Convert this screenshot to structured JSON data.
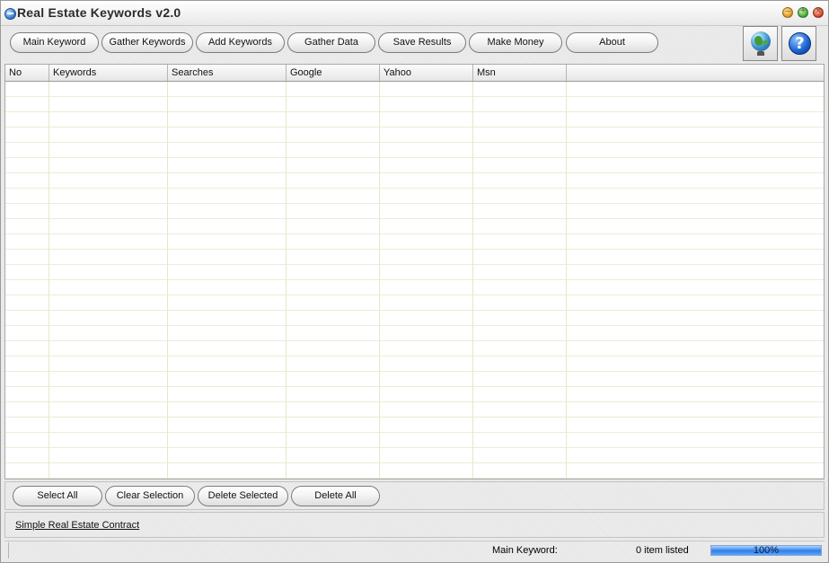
{
  "window": {
    "title": "Real Estate Keywords v2.0",
    "minimize_glyph": "–",
    "maximize_glyph": "+",
    "close_glyph": "×"
  },
  "toolbar": {
    "main_keyword": "Main Keyword",
    "gather_keywords": "Gather Keywords",
    "add_keywords": "Add Keywords",
    "gather_data": "Gather Data",
    "save_results": "Save Results",
    "make_money": "Make Money",
    "about": "About",
    "help_glyph": "?",
    "icons": [
      "globe-icon",
      "help-icon"
    ]
  },
  "grid": {
    "columns": [
      "No",
      "Keywords",
      "Searches",
      "Google",
      "Yahoo",
      "Msn"
    ],
    "rows": [],
    "colors": {
      "grid_line": "#e6e8c8",
      "row_line": "#ececd8"
    }
  },
  "actions": {
    "select_all": "Select All",
    "clear_selection": "Clear Selection",
    "delete_selected": "Delete Selected",
    "delete_all": "Delete All"
  },
  "footer": {
    "link_text": "Simple Real Estate Contract"
  },
  "status": {
    "main_keyword_label": "Main Keyword:",
    "items_listed": "0 item listed",
    "progress_text": "100%",
    "progress_value": 100,
    "progress_color": "#2f7fe8"
  }
}
